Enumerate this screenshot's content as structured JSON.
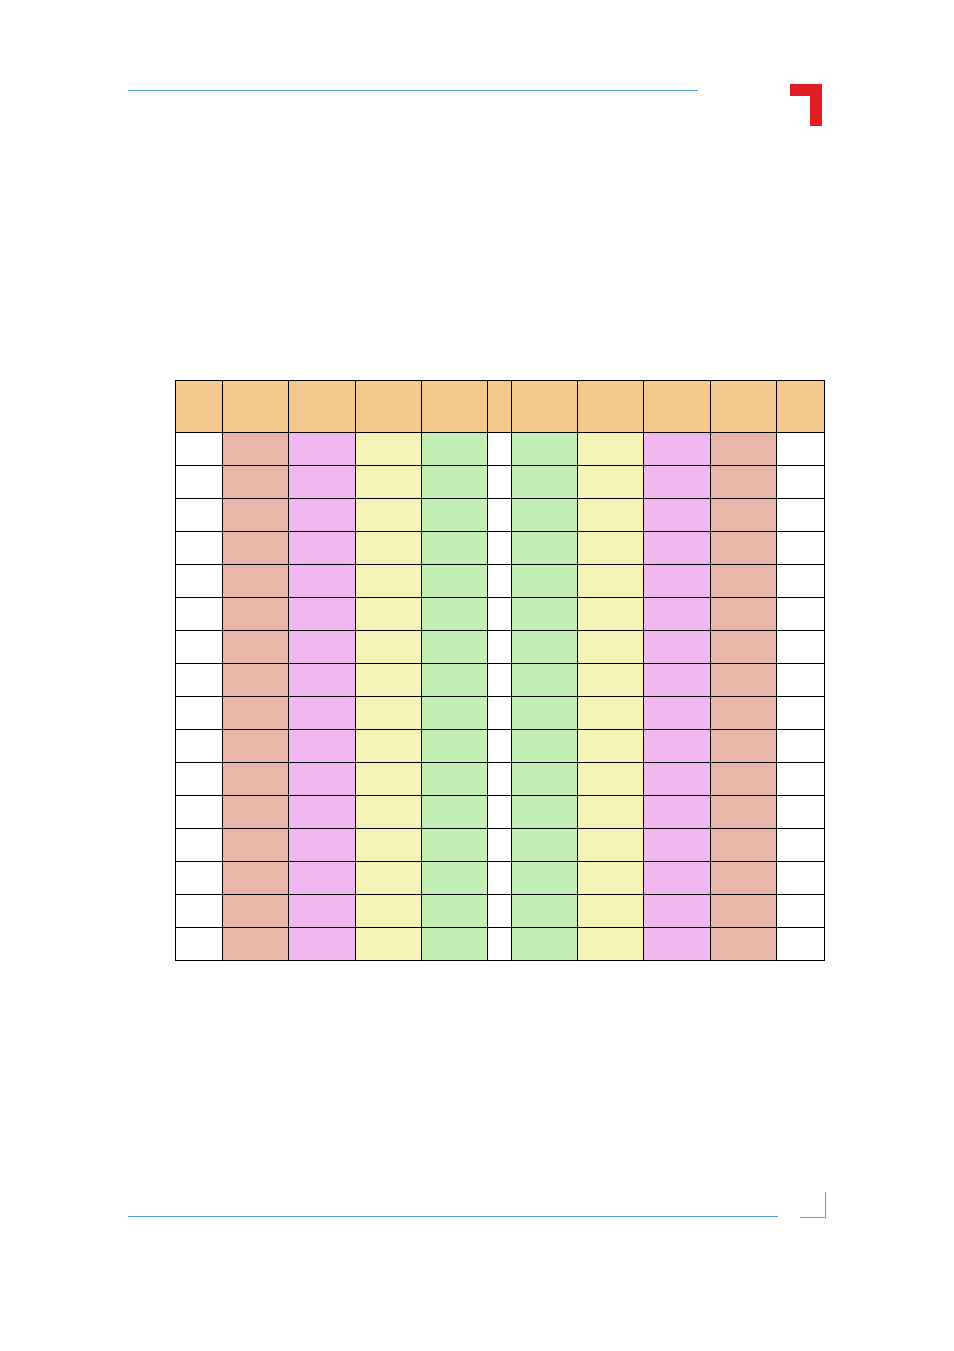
{
  "table": {
    "headers": [
      "",
      "",
      "",
      "",
      "",
      "",
      "",
      "",
      "",
      "",
      ""
    ],
    "row_count": 16
  }
}
